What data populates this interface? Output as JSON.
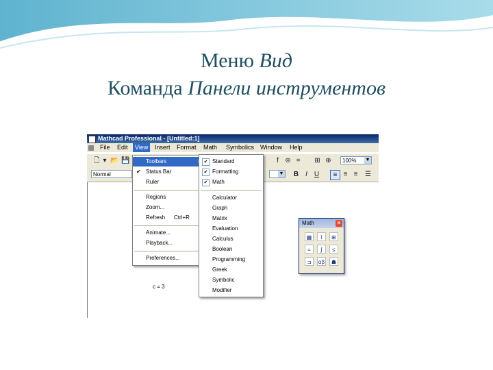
{
  "slide": {
    "title_line1_plain": "Меню",
    "title_line1_italic": "Вид",
    "title_line2_plain": "Команда",
    "title_line2_italic": "Панели инструментов"
  },
  "window": {
    "title": "Mathcad Professional - [Untitled:1]"
  },
  "menubar": [
    "File",
    "Edit",
    "View",
    "Insert",
    "Format",
    "Math",
    "Symbolics",
    "Window",
    "Help"
  ],
  "toolbar": {
    "style_value": "Normal",
    "zoom_value": "100%",
    "bold": "B",
    "italic": "I",
    "underline": "U"
  },
  "view_menu": {
    "toolbars": "Toolbars",
    "status_bar": "Status Bar",
    "ruler": "Ruler",
    "regions": "Regions",
    "zoom": "Zoom...",
    "refresh": "Refresh",
    "refresh_shortcut": "Ctrl+R",
    "animate": "Animate...",
    "playback": "Playback...",
    "preferences": "Preferences..."
  },
  "toolbars_submenu": [
    "Standard",
    "Formatting",
    "Math",
    "Calculator",
    "Graph",
    "Matrix",
    "Evaluation",
    "Calculus",
    "Boolean",
    "Programming",
    "Greek",
    "Symbolic",
    "Modifier"
  ],
  "document": {
    "expression": "c = 3"
  },
  "math_palette": {
    "title": "Math"
  }
}
